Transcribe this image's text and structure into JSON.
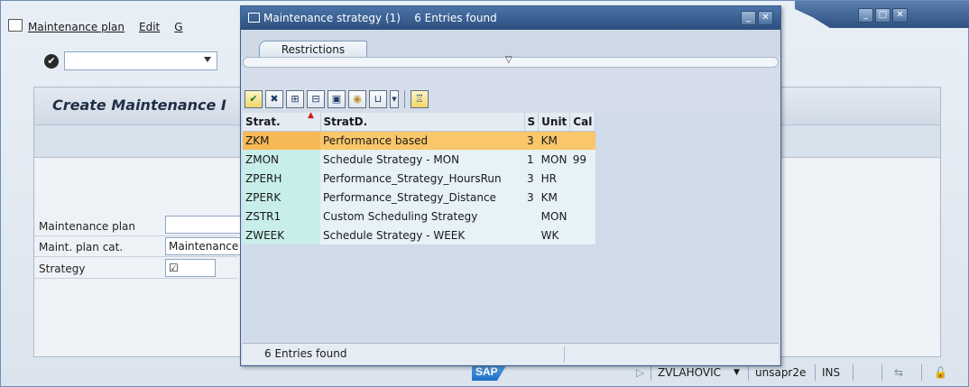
{
  "main": {
    "menu": [
      "Maintenance plan",
      "Edit",
      "G"
    ],
    "page_title": "Create Maintenance I",
    "form": {
      "maintenance_plan_label": "Maintenance plan",
      "maintenance_plan_value": "",
      "plan_cat_label": "Maint. plan cat.",
      "plan_cat_value": "Maintenance",
      "strategy_label": "Strategy",
      "strategy_value": "☑"
    }
  },
  "popup": {
    "title": "Maintenance strategy (1)",
    "title_count": "6 Entries found",
    "tab_restrictions": "Restrictions",
    "columns": [
      "Strat.",
      "StratD.",
      "S",
      "Unit",
      "Cal"
    ],
    "rows": [
      {
        "strat": "ZKM",
        "desc": "Performance based",
        "s": "3",
        "unit": "KM",
        "cal": "",
        "selected": true
      },
      {
        "strat": "ZMON",
        "desc": "Schedule Strategy - MON",
        "s": "1",
        "unit": "MON",
        "cal": "99"
      },
      {
        "strat": "ZPERH",
        "desc": "Performance_Strategy_HoursRun",
        "s": "3",
        "unit": "HR",
        "cal": ""
      },
      {
        "strat": "ZPERK",
        "desc": "Performance_Strategy_Distance",
        "s": "3",
        "unit": "KM",
        "cal": ""
      },
      {
        "strat": "ZSTR1",
        "desc": "Custom Scheduling Strategy",
        "s": "",
        "unit": "MON",
        "cal": ""
      },
      {
        "strat": "ZWEEK",
        "desc": "Schedule Strategy - WEEK",
        "s": "",
        "unit": "WK",
        "cal": ""
      }
    ],
    "status": "6 Entries found"
  },
  "statusbar": {
    "sap_logo": "SAP",
    "user": "ZVLAHOVIC",
    "server": "unsapr2e",
    "mode": "INS"
  },
  "colors": {
    "selected_row": "#f9c66a",
    "key_col": "#c8eeea",
    "title_bar": "#2c4f7f"
  }
}
